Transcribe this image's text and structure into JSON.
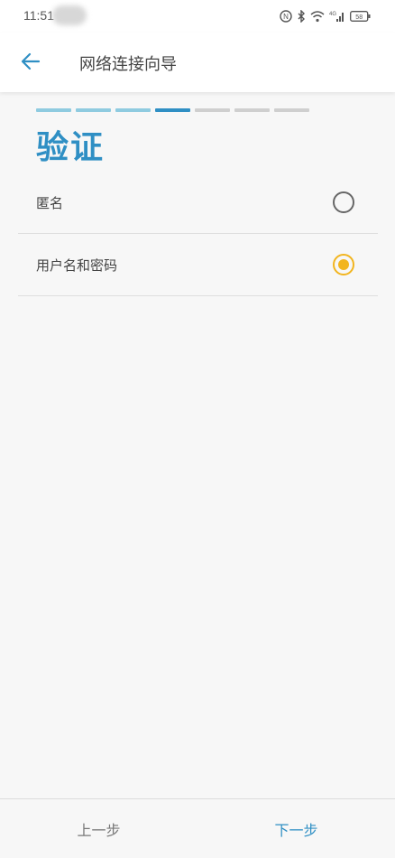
{
  "status_bar": {
    "time": "11:51",
    "icons": [
      "nfc-icon",
      "bluetooth-icon",
      "wifi-icon",
      "cellular-4g-icon",
      "battery-icon"
    ],
    "battery_level": "58"
  },
  "app_bar": {
    "title": "网络连接向导",
    "back_icon": "arrow-left-icon"
  },
  "stepper": {
    "total_steps": 7,
    "completed_steps": 3,
    "current_step": 4
  },
  "section_title": "验证",
  "options": [
    {
      "label": "匿名",
      "selected": false
    },
    {
      "label": "用户名和密码",
      "selected": true
    }
  ],
  "bottom_bar": {
    "prev_label": "上一步",
    "next_label": "下一步"
  },
  "colors": {
    "accent": "#2f8fc4",
    "accent_light": "#8fcbe0",
    "radio_selected": "#f2b51f",
    "background": "#f7f7f7"
  }
}
